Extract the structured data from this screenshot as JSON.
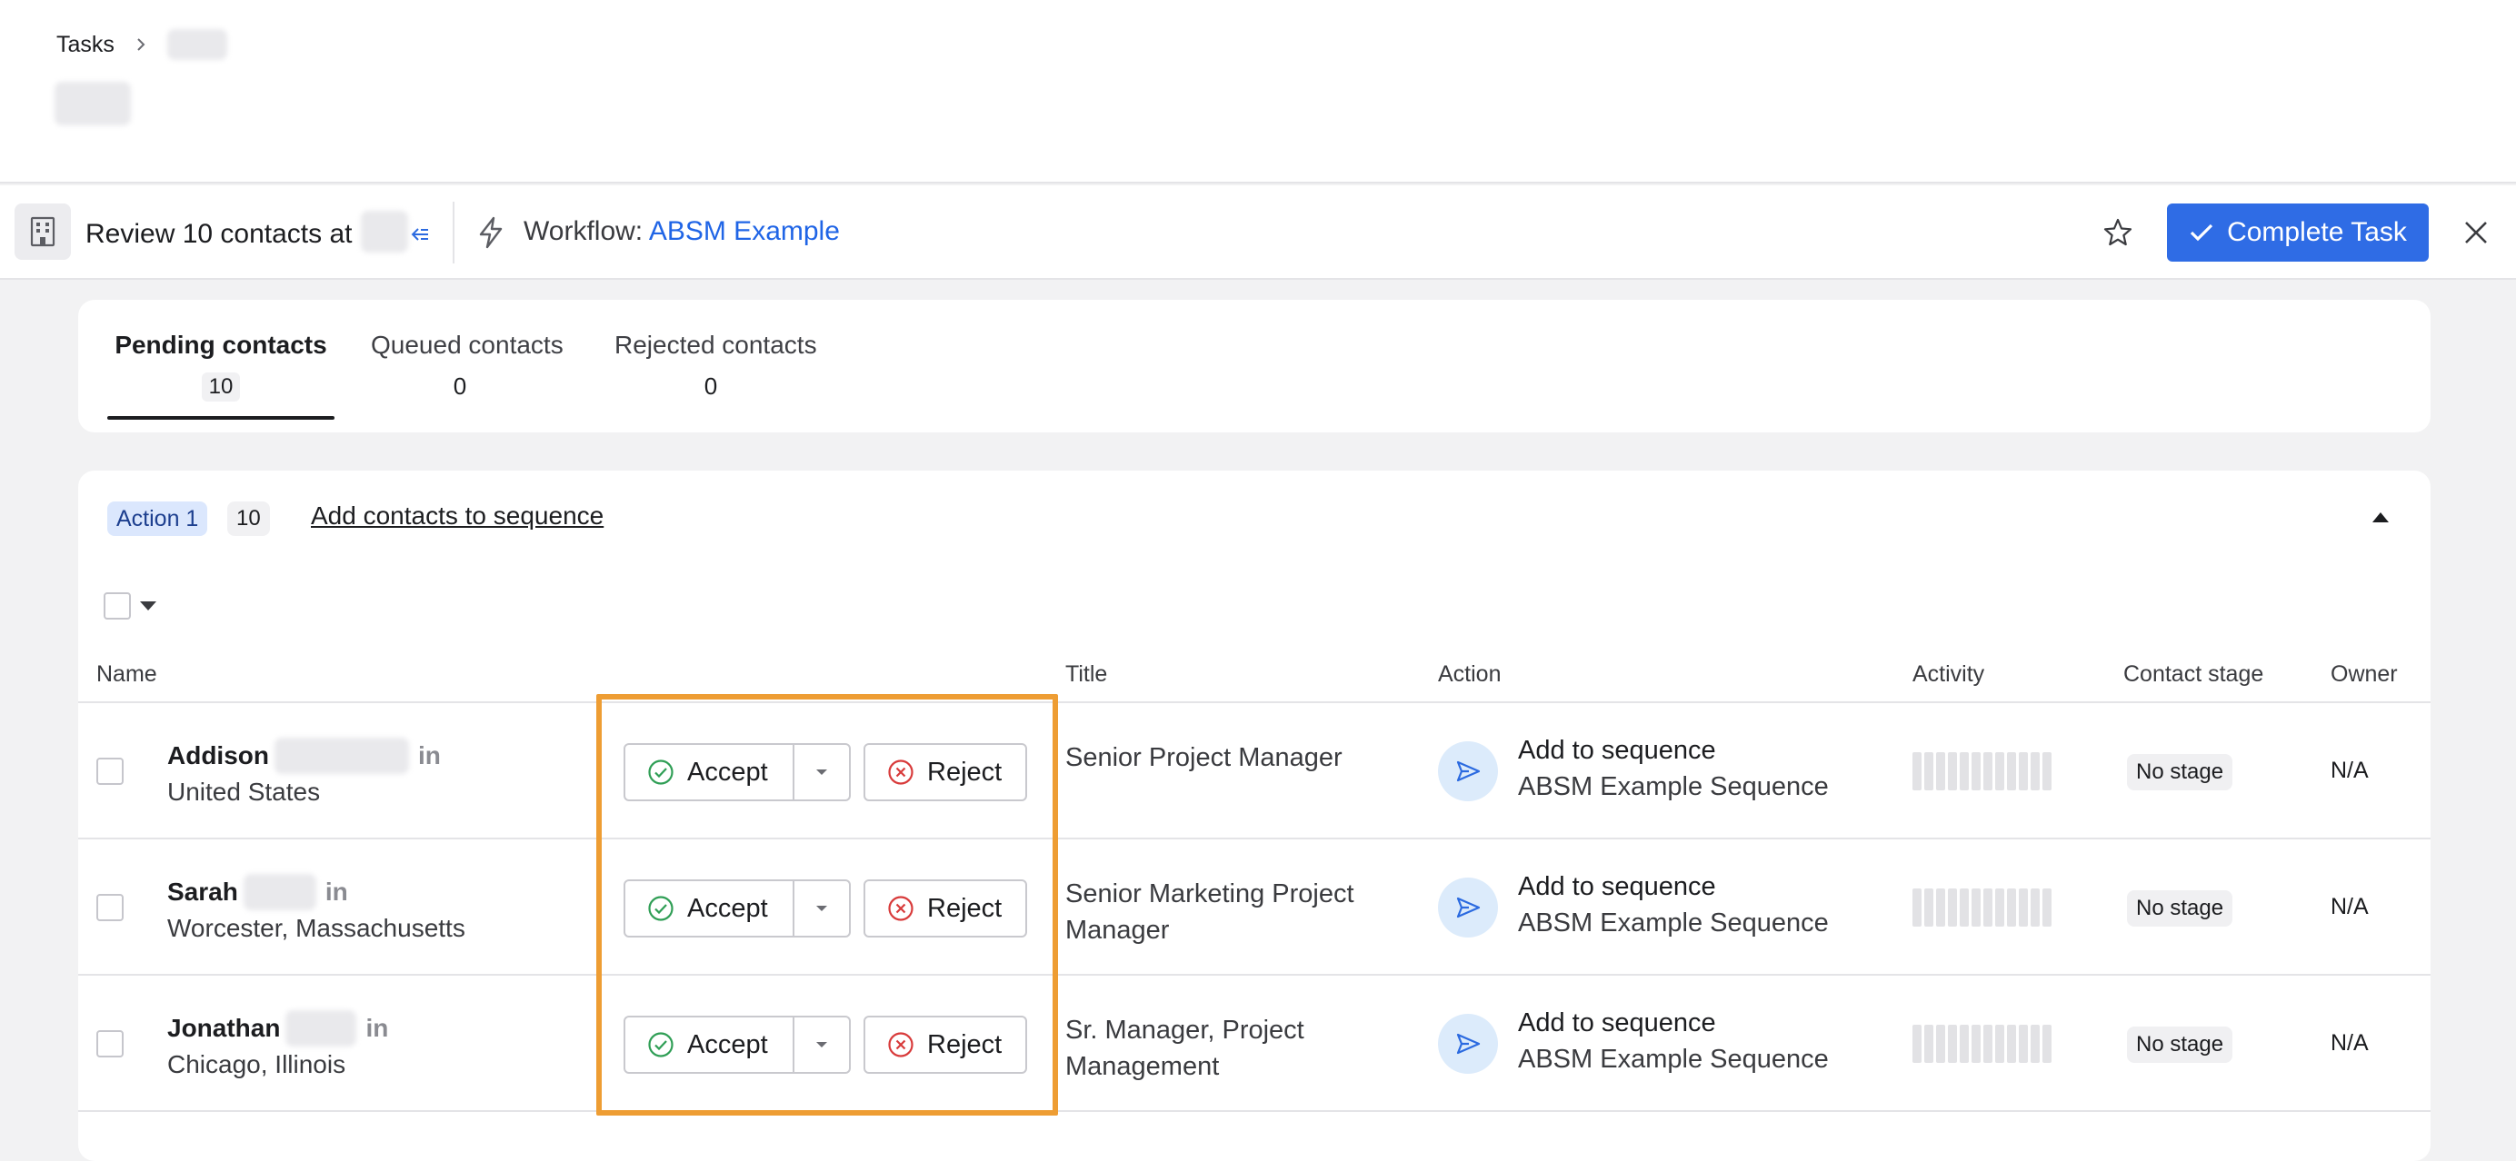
{
  "breadcrumb": {
    "root": "Tasks"
  },
  "toolbar": {
    "task_title": "Review 10 contacts at",
    "workflow_label": "Workflow:",
    "workflow_name": "ABSM Example",
    "complete_label": "Complete Task",
    "accent": "#2f6ce5"
  },
  "tabs": [
    {
      "label": "Pending contacts",
      "count": "10"
    },
    {
      "label": "Queued contacts",
      "count": "0"
    },
    {
      "label": "Rejected contacts",
      "count": "0"
    }
  ],
  "action_section": {
    "badge": "Action 1",
    "count": "10",
    "link": "Add contacts to sequence"
  },
  "columns": {
    "name": "Name",
    "title": "Title",
    "action": "Action",
    "activity": "Activity",
    "contact_stage": "Contact stage",
    "owner": "Owner"
  },
  "buttons": {
    "accept": "Accept",
    "reject": "Reject"
  },
  "rows": [
    {
      "first_name": "Addison",
      "location": "United States",
      "linkedin": "in",
      "title": "Senior Project Manager",
      "action_title": "Add to sequence",
      "action_sub": "ABSM Example Sequence",
      "stage": "No stage",
      "owner": "N/A"
    },
    {
      "first_name": "Sarah",
      "location": "Worcester, Massachusetts",
      "linkedin": "in",
      "title": "Senior Marketing Project Manager",
      "action_title": "Add to sequence",
      "action_sub": "ABSM Example Sequence",
      "stage": "No stage",
      "owner": "N/A"
    },
    {
      "first_name": "Jonathan",
      "location": "Chicago, Illinois",
      "linkedin": "in",
      "title": "Sr. Manager, Project Management",
      "action_title": "Add to sequence",
      "action_sub": "ABSM Example Sequence",
      "stage": "No stage",
      "owner": "N/A"
    }
  ],
  "colors": {
    "highlight": "#ee9d33",
    "accept_icon": "#2f9e55",
    "reject_icon": "#d83a3a"
  }
}
